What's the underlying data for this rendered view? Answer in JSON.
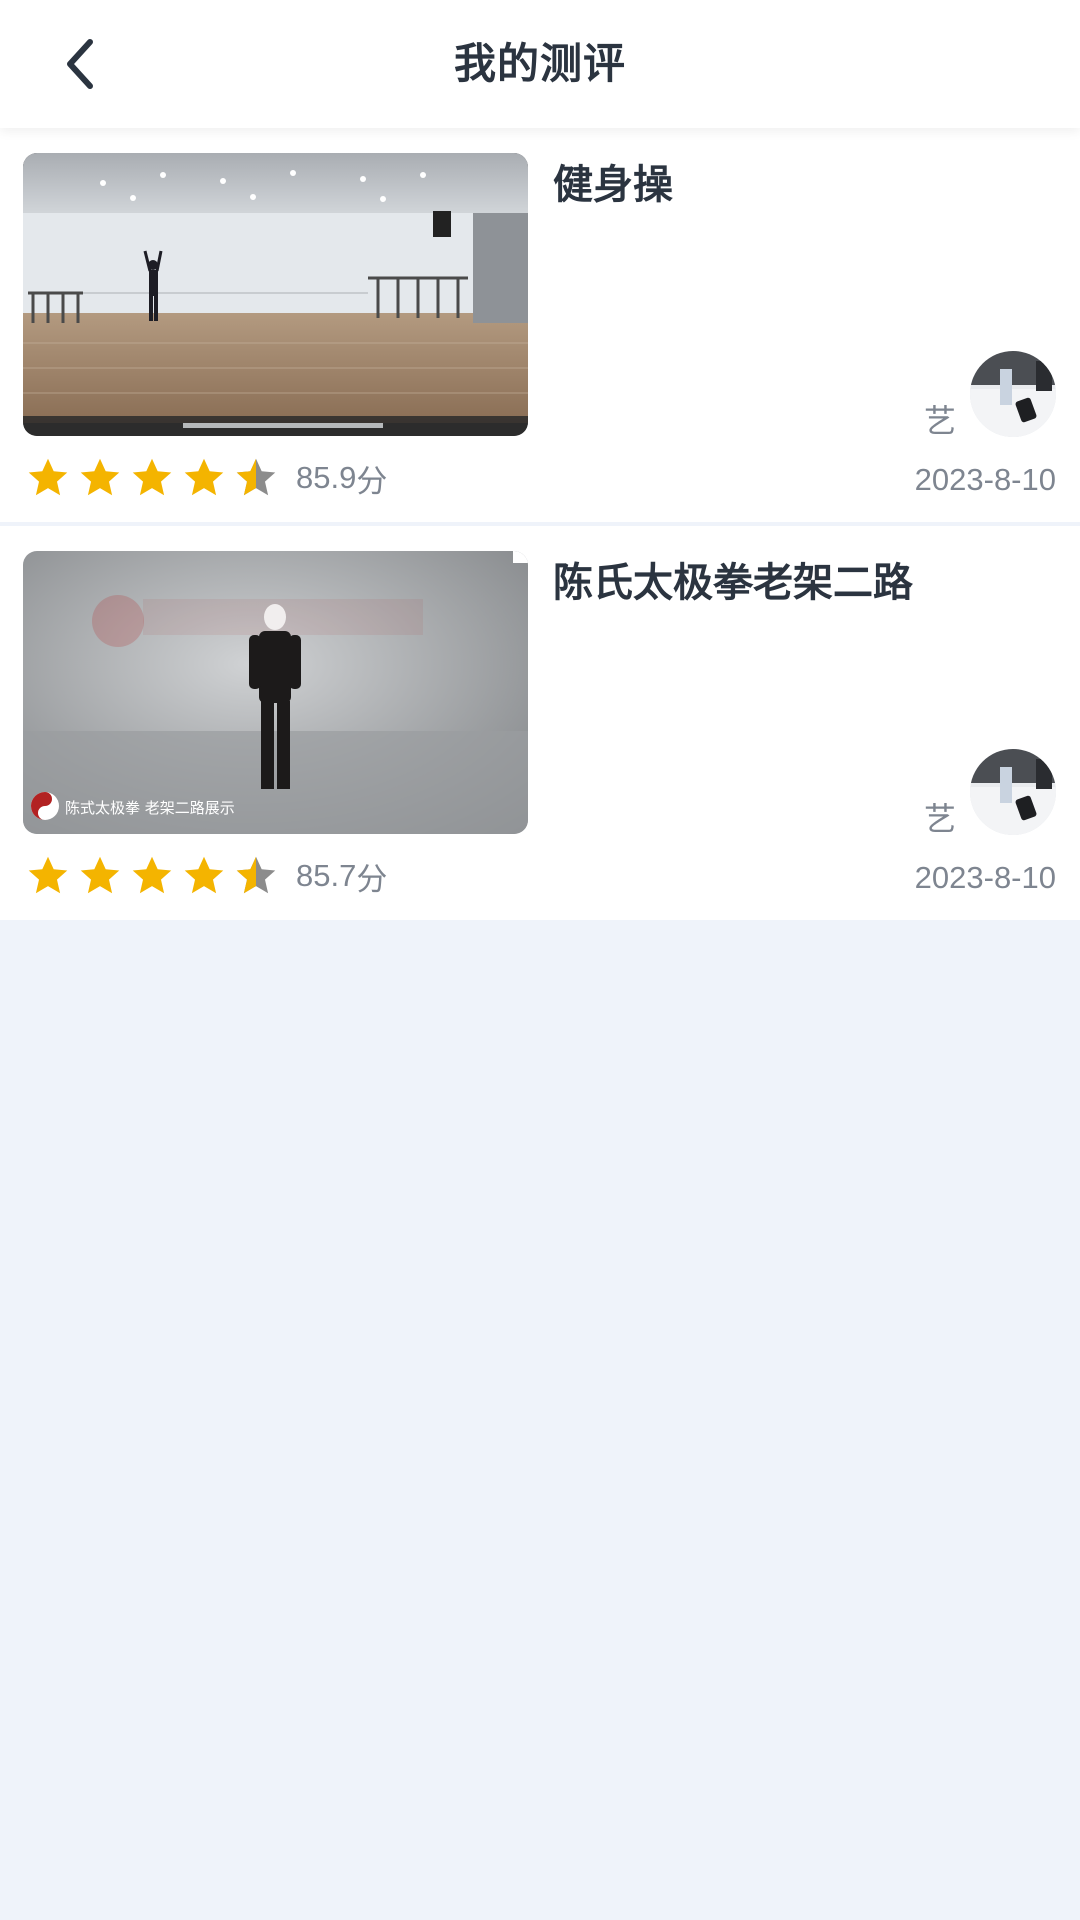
{
  "header": {
    "title": "我的测评"
  },
  "colors": {
    "star": "#f4b400",
    "star_empty": "#8c8c8c"
  },
  "evaluations": [
    {
      "title": "健身操",
      "score": "85.9",
      "score_unit": "分",
      "rating": 4.5,
      "author": "艺",
      "date": "2023-8-10"
    },
    {
      "title": "陈氏太极拳老架二路",
      "score": "85.7",
      "score_unit": "分",
      "rating": 4.5,
      "author": "艺",
      "date": "2023-8-10",
      "thumbnail_caption": "陈式太极拳 老架二路展示"
    }
  ]
}
